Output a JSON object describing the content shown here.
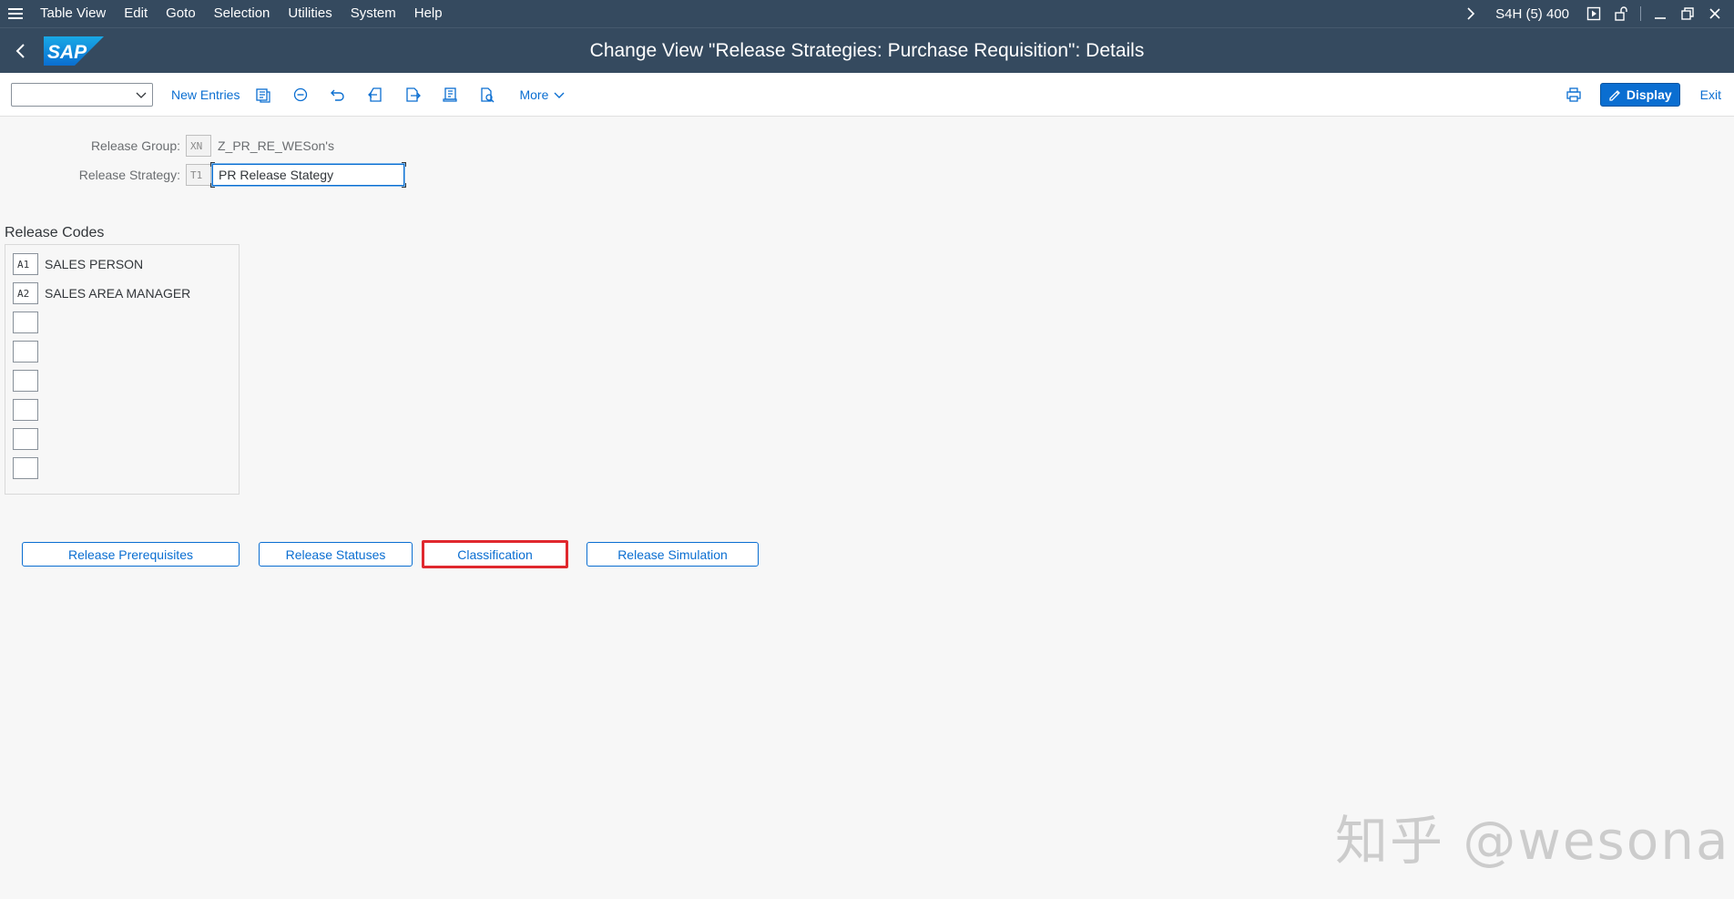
{
  "menubar": {
    "items": [
      "Table View",
      "Edit",
      "Goto",
      "Selection",
      "Utilities",
      "System",
      "Help"
    ],
    "system": "S4H (5) 400"
  },
  "titlebar": {
    "logo": "SAP",
    "title": "Change View \"Release Strategies: Purchase Requisition\": Details"
  },
  "toolbar": {
    "combo_value": "",
    "new_entries": "New Entries",
    "more": "More",
    "display": "Display",
    "exit": "Exit"
  },
  "form": {
    "release_group_label": "Release Group:",
    "release_group_key": "XN",
    "release_group_value": "Z_PR_RE_WESon's",
    "release_strategy_label": "Release Strategy:",
    "release_strategy_key": "T1",
    "release_strategy_value": "PR Release Stategy"
  },
  "release_codes": {
    "title": "Release Codes",
    "rows": [
      {
        "code": "A1",
        "desc": "SALES PERSON"
      },
      {
        "code": "A2",
        "desc": "SALES AREA MANAGER"
      },
      {
        "code": "",
        "desc": ""
      },
      {
        "code": "",
        "desc": ""
      },
      {
        "code": "",
        "desc": ""
      },
      {
        "code": "",
        "desc": ""
      },
      {
        "code": "",
        "desc": ""
      },
      {
        "code": "",
        "desc": ""
      }
    ]
  },
  "buttons": {
    "prerequisites": "Release Prerequisites",
    "statuses": "Release Statuses",
    "classification": "Classification",
    "simulation": "Release Simulation"
  },
  "watermark": "知乎 @wesona",
  "colors": {
    "shell": "#354a5f",
    "accent": "#0a6ed1",
    "highlight": "#e0282e"
  }
}
